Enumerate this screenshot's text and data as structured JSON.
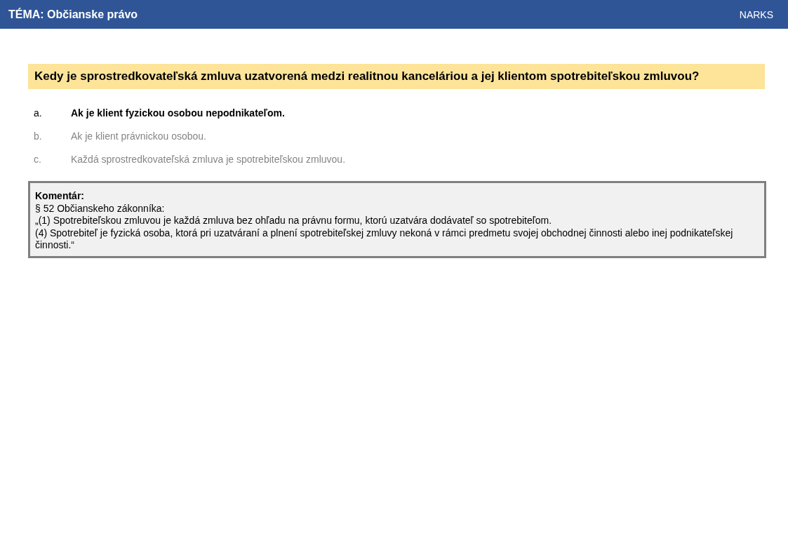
{
  "header": {
    "topic": "TÉMA: Občianske právo",
    "brand": "NARKS"
  },
  "question": "Kedy je sprostredkovateľská zmluva uzatvorená medzi realitnou kanceláriou a jej klientom spotrebiteľskou zmluvou?",
  "answers": [
    {
      "letter": "a.",
      "text": "Ak je klient fyzickou osobou nepodnikateľom.",
      "correct": true
    },
    {
      "letter": "b.",
      "text": "Ak je klient právnickou osobou.",
      "correct": false
    },
    {
      "letter": "c.",
      "text": "Každá sprostredkovateľská zmluva je spotrebiteľskou zmluvou.",
      "correct": false
    }
  ],
  "comment": {
    "title": "Komentár:",
    "lines": [
      "§ 52 Občianskeho zákonníka:",
      "„(1) Spotrebiteľskou zmluvou je každá zmluva bez ohľadu na právnu formu, ktorú uzatvára dodávateľ so spotrebiteľom.",
      "(4) Spotrebiteľ je fyzická osoba, ktorá pri uzatváraní a plnení spotrebiteľskej zmluvy nekoná v rámci predmetu svojej obchodnej činnosti alebo inej podnikateľskej činnosti.“"
    ]
  }
}
